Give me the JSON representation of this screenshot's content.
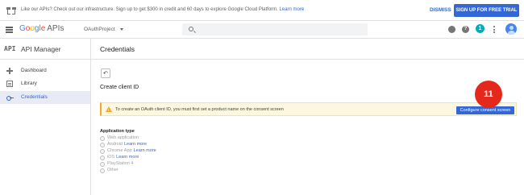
{
  "promo": {
    "message": "Like our APIs? Check out our infrastructure. Sign up to get $300 in credit and 60 days to explore Google Cloud Platform.",
    "learn_more": "Learn more",
    "dismiss": "DISMISS",
    "signup": "SIGN UP FOR FREE TRIAL"
  },
  "topbar": {
    "logo_letters": [
      "G",
      "o",
      "o",
      "g",
      "l",
      "e"
    ],
    "logo_suffix": "APIs",
    "project": "OAuthProject",
    "help": "?",
    "notifications": "1"
  },
  "sidebar": {
    "logo": "API",
    "title": "API Manager",
    "items": [
      {
        "label": "Dashboard",
        "icon": "dashboard-icon",
        "active": false
      },
      {
        "label": "Library",
        "icon": "library-icon",
        "active": false
      },
      {
        "label": "Credentials",
        "icon": "key-icon",
        "active": true
      }
    ]
  },
  "main": {
    "title": "Credentials",
    "back_icon": "back-arrow-icon",
    "subtitle": "Create client ID",
    "warning": "To create an OAuth client ID, you must first set a product name on the consent screen",
    "configure_button": "Configure consent screen",
    "badge": "11",
    "application_type_label": "Application type",
    "application_types": [
      {
        "label": "Web application",
        "link": ""
      },
      {
        "label": "Android",
        "link": "Learn more"
      },
      {
        "label": "Chrome App",
        "link": "Learn more"
      },
      {
        "label": "iOS",
        "link": "Learn more"
      },
      {
        "label": "PlayStation 4",
        "link": ""
      },
      {
        "label": "Other",
        "link": ""
      }
    ]
  },
  "colors": {
    "accent": "#3367d6",
    "warning": "#f9a825",
    "badge": "#e4281b"
  }
}
